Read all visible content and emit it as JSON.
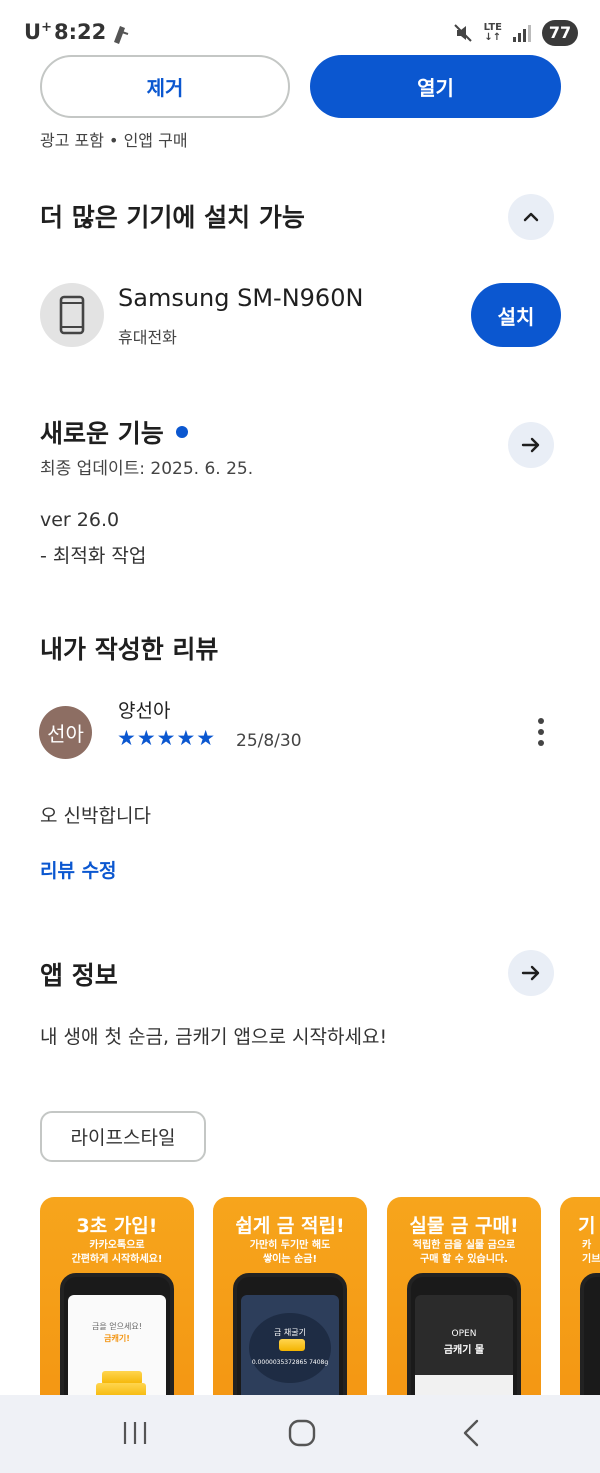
{
  "status_bar": {
    "carrier": "U",
    "carrier_sup": "+",
    "time": "8:22",
    "network": "LTE",
    "battery": "77"
  },
  "actions": {
    "remove_label": "제거",
    "open_label": "열기"
  },
  "meta_line": "광고 포함  •  인앱 구매",
  "devices": {
    "title": "더 많은 기기에 설치 가능",
    "device_name": "Samsung SM-N960N",
    "device_type": "휴대전화",
    "install_label": "설치"
  },
  "whats_new": {
    "title": "새로운 기능",
    "updated": "최종 업데이트: 2025. 6. 25.",
    "version": "ver 26.0",
    "note": "- 최적화 작업"
  },
  "my_review": {
    "title": "내가 작성한 리뷰",
    "avatar_text": "선아",
    "reviewer": "양선아",
    "rating": 5,
    "stars": "★★★★★",
    "date": "25/8/30",
    "text": "오 신박합니다",
    "edit_label": "리뷰 수정"
  },
  "app_info": {
    "title": "앱 정보",
    "description": "내 생애 첫 순금, 금캐기 앱으로 시작하세요!",
    "category_chip": "라이프스타일"
  },
  "screenshots": [
    {
      "title": "3초 가입!",
      "line1": "카카오톡으로",
      "line2": "간편하게 시작하세요!",
      "screen_line1": "금을 얻으세요!",
      "screen_line2": "금캐기!"
    },
    {
      "title": "쉽게 금 적립!",
      "line1": "가만히 두기만 해도",
      "line2": "쌓이는 순금!",
      "screen_line1": "0.0000035372865 7408g",
      "screen_line2": "금 채굴기"
    },
    {
      "title": "실물 금 구매!",
      "line1": "적립한 금을 실물 금으로",
      "line2": "구매 할 수 있습니다.",
      "screen_line1": "OPEN",
      "screen_line2": "금캐기 몰"
    },
    {
      "title": "기",
      "line1": "카",
      "line2": "기브",
      "screen_line1": "",
      "screen_line2": ""
    }
  ]
}
